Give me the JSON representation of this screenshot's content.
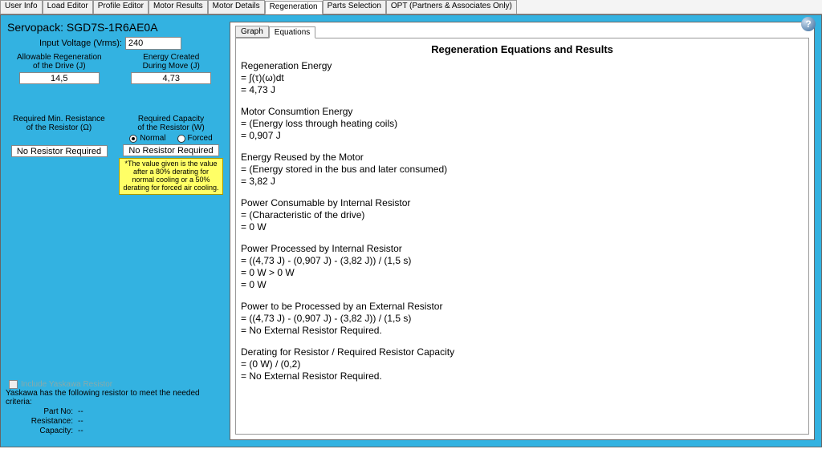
{
  "tabs": [
    "User Info",
    "Load Editor",
    "Profile Editor",
    "Motor Results",
    "Motor Details",
    "Regeneration",
    "Parts Selection",
    "OPT (Partners & Associates Only)"
  ],
  "active_tab_index": 5,
  "servopack_label": "Servopack: SGD7S-1R6AE0A",
  "input_voltage_label": "Input Voltage (Vrms):",
  "input_voltage_value": "240",
  "allow_regen_label_1": "Allowable Regeneration",
  "allow_regen_label_2": "of the Drive (J)",
  "allow_regen_value": "14,5",
  "energy_created_label_1": "Energy Created",
  "energy_created_label_2": "During Move (J)",
  "energy_created_value": "4,73",
  "req_min_res_label_1": "Required Min. Resistance",
  "req_min_res_label_2": "of the Resistor (Ω)",
  "req_min_res_value": "No Resistor Required",
  "req_cap_label_1": "Required Capacity",
  "req_cap_label_2": "of the Resistor (W)",
  "radio_normal": "Normal",
  "radio_forced": "Forced",
  "req_cap_value": "No Resistor Required",
  "note_text": "*The value given is the value after a 80% derating for normal cooling or a 50% derating for forced air cooling.",
  "include_label": "Include Yaskawa Resistor",
  "criteria_header": "Yaskawa has the following resistor to meet the needed criteria:",
  "criteria_partno_label": "Part No:",
  "criteria_partno_val": "--",
  "criteria_res_label": "Resistance:",
  "criteria_res_val": "--",
  "criteria_cap_label": "Capacity:",
  "criteria_cap_val": "--",
  "subtabs": [
    "Graph",
    "Equations"
  ],
  "active_subtab_index": 1,
  "eq_title": "Regeneration Equations and Results",
  "blocks": [
    {
      "hd": "Regeneration Energy",
      "l1": " = ∫(τ)(ω)dt",
      "l2": " = 4,73 J"
    },
    {
      "hd": "Motor Consumtion Energy",
      "l1": " = (Energy loss through heating coils)",
      "l2": " = 0,907 J"
    },
    {
      "hd": "Energy Reused by the Motor",
      "l1": " = (Energy stored in the bus and later consumed)",
      "l2": " = 3,82 J"
    },
    {
      "hd": "Power Consumable by Internal Resistor",
      "l1": " = (Characteristic of the drive)",
      "l2": " = 0 W"
    },
    {
      "hd": "Power Processed by Internal Resistor",
      "l1": " = ((4,73 J) - (0,907 J) - (3,82 J)) / (1,5 s)",
      "l2": " = 0 W > 0 W",
      "l3": " = 0 W"
    },
    {
      "hd": "Power to be Processed by an External Resistor",
      "l1": " = ((4,73 J) - (0,907 J) - (3,82 J)) / (1,5 s)",
      "l2": " = No External Resistor Required."
    },
    {
      "hd": "Derating for Resistor / Required Resistor Capacity",
      "l1": " = (0 W) / (0,2)",
      "l2": " = No External Resistor Required."
    }
  ],
  "help_glyph": "?"
}
